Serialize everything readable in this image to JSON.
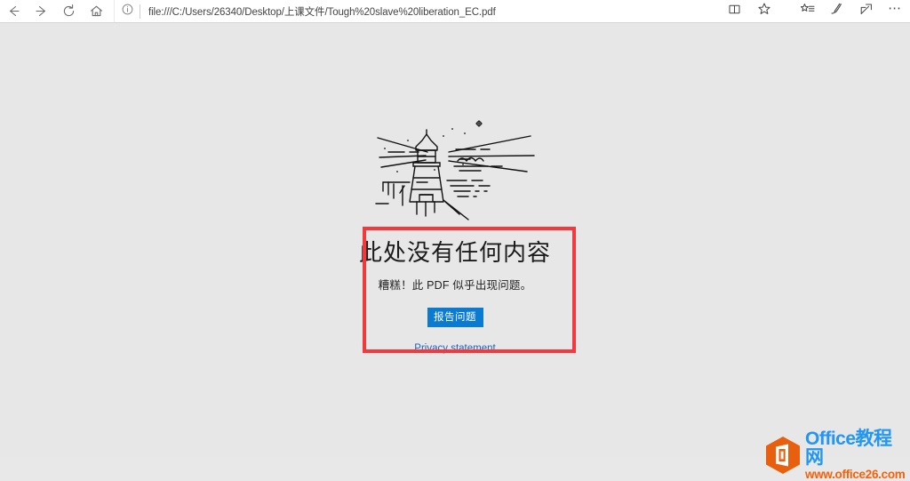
{
  "browser": {
    "nav": [
      {
        "name": "back",
        "label": "Back",
        "icon": "arrow-left-icon"
      },
      {
        "name": "forward",
        "label": "Forward",
        "icon": "arrow-right-icon"
      },
      {
        "name": "refresh",
        "label": "Refresh",
        "icon": "refresh-icon"
      },
      {
        "name": "home",
        "label": "Home",
        "icon": "home-icon"
      }
    ],
    "address": {
      "url": "file:///C:/Users/26340/Desktop/上课文件/Tough%20slave%20liberation_EC.pdf",
      "placeholder": "Search or enter web address",
      "site_info_icon": "info-circle-icon"
    },
    "right_icons": [
      {
        "name": "reading-view",
        "icon": "book-icon"
      },
      {
        "name": "favorites",
        "icon": "star-icon"
      },
      {
        "name": "reading-list",
        "icon": "star-list-icon"
      },
      {
        "name": "web-notes",
        "icon": "pen-icon"
      },
      {
        "name": "share",
        "icon": "share-icon"
      },
      {
        "name": "more",
        "icon": "ellipsis-icon",
        "label": "⋯"
      }
    ]
  },
  "error_page": {
    "illustration": "lighthouse-illustration",
    "title": "此处没有任何内容",
    "subtitle": "糟糕！此 PDF 似乎出现问题。",
    "report_button": "报告问题",
    "privacy_link": "Privacy statement"
  },
  "annotation": {
    "name": "red-highlight-rectangle",
    "color": "#f4383b"
  },
  "watermark": {
    "brand": "Office教程网",
    "site": "www.office26.com",
    "logo_icon": "office-hexagon-logo",
    "brand_color": "#2196f3",
    "site_color": "#f4610a",
    "logo_color": "#e8600e"
  },
  "colors": {
    "accent_button": "#0a7bd0",
    "link": "#1763c6",
    "page_background": "#e7e7e7",
    "toolbar_background": "#ffffff"
  }
}
